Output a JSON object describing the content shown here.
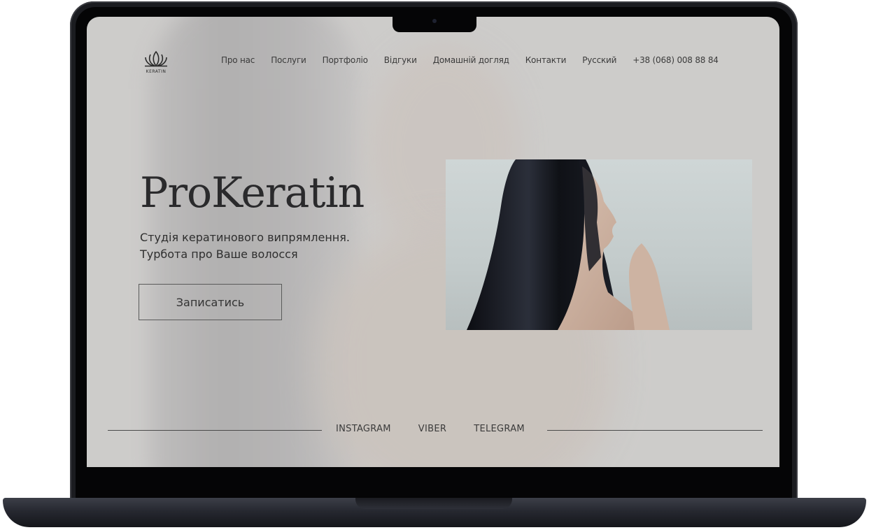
{
  "site": {
    "logo_text": "KERATIN",
    "nav": [
      {
        "label": "Про нас"
      },
      {
        "label": "Послуги"
      },
      {
        "label": "Портфоліо"
      },
      {
        "label": "Відгуки"
      },
      {
        "label": "Домашній догляд"
      },
      {
        "label": "Контакти"
      },
      {
        "label": "Русский"
      }
    ],
    "phone": "+38 (068) 008 88 84"
  },
  "hero": {
    "title": "ProKeratin",
    "subtitle_line1": "Студія кератинового випрямлення.",
    "subtitle_line2": "Турбота про Ваше волосся",
    "cta_label": "Записатись"
  },
  "social": {
    "instagram": "INSTAGRAM",
    "viber": "VIBER",
    "telegram": "TELEGRAM"
  },
  "colors": {
    "screen_bg": "#cbc9c8",
    "text": "#2a2a2c",
    "frame": "#1b1c20"
  },
  "icons": {
    "logo": "lotus-icon",
    "camera": "camera-icon"
  }
}
